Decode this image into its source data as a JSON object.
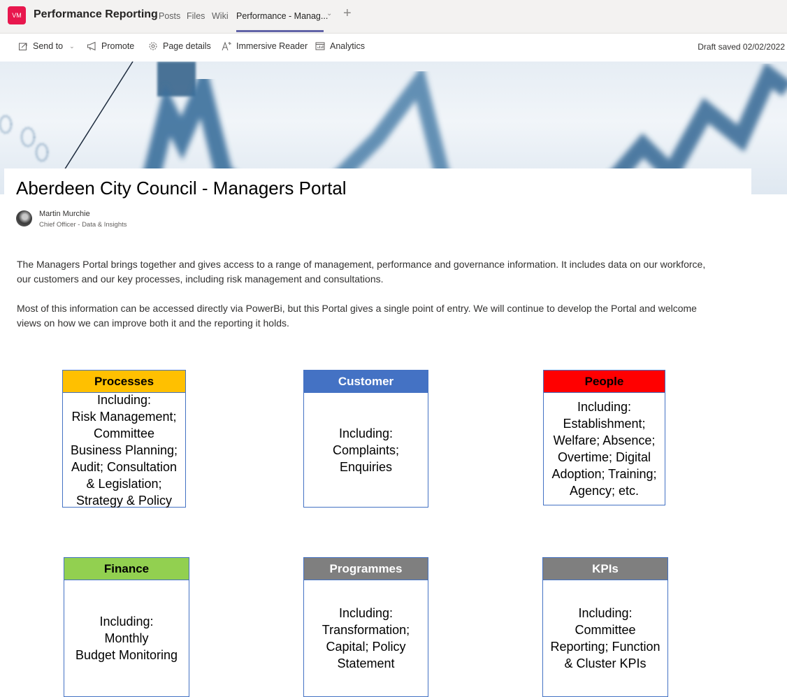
{
  "header": {
    "team_initials": "VM",
    "team_name": "Performance Reporting",
    "tabs": [
      {
        "label": "Posts"
      },
      {
        "label": "Files"
      },
      {
        "label": "Wiki"
      },
      {
        "label": "Performance - Manag..."
      }
    ],
    "active_tab": "Performance - Manag...",
    "accent_color": "#6264a7",
    "team_color": "#e8174d"
  },
  "command_bar": {
    "items": [
      {
        "label": "Send to",
        "icon": "share-icon"
      },
      {
        "label": "Promote",
        "icon": "megaphone-icon"
      },
      {
        "label": "Page details",
        "icon": "gear-icon"
      },
      {
        "label": "Immersive Reader",
        "icon": "immersive-reader-icon"
      },
      {
        "label": "Analytics",
        "icon": "analytics-icon"
      }
    ],
    "status": "Draft saved 02/02/2022"
  },
  "page": {
    "title": "Aberdeen City Council - Managers Portal",
    "author": {
      "name": "Martin Murchie",
      "role": "Chief Officer - Data & Insights"
    },
    "paragraphs": [
      "The Managers Portal brings together and gives access to a range of management, performance and governance information.  It includes data on our workforce, our customers and our key processes, including risk management and consultations.",
      "Most of this information can be accessed directly via PowerBi, but this Portal gives a single point of entry.  We will continue to develop the Portal and welcome views on how we can improve both it and the reporting it holds."
    ]
  },
  "tiles": [
    {
      "title": "Processes",
      "color": "#ffc000",
      "text_color": "#000000",
      "body": "Including:\nRisk Management;\nCommittee\nBusiness Planning;\nAudit; Consultation\n& Legislation;\nStrategy & Policy"
    },
    {
      "title": "Customer",
      "color": "#4472c4",
      "text_color": "#ffffff",
      "body": "Including:\nComplaints;\nEnquiries"
    },
    {
      "title": "People",
      "color": "#ff0000",
      "text_color": "#000000",
      "body": "Including:\nEstablishment;\nWelfare; Absence;\nOvertime; Digital\nAdoption; Training;\nAgency; etc."
    },
    {
      "title": "Finance",
      "color": "#92d050",
      "text_color": "#000000",
      "body": "Including:\nMonthly\nBudget Monitoring"
    },
    {
      "title": "Programmes",
      "color": "#7f7f7f",
      "text_color": "#ffffff",
      "body": "Including:\nTransformation;\nCapital; Policy\nStatement"
    },
    {
      "title": "KPIs",
      "color": "#7f7f7f",
      "text_color": "#ffffff",
      "body": "Including:\nCommittee\nReporting; Function\n& Cluster KPIs"
    }
  ]
}
